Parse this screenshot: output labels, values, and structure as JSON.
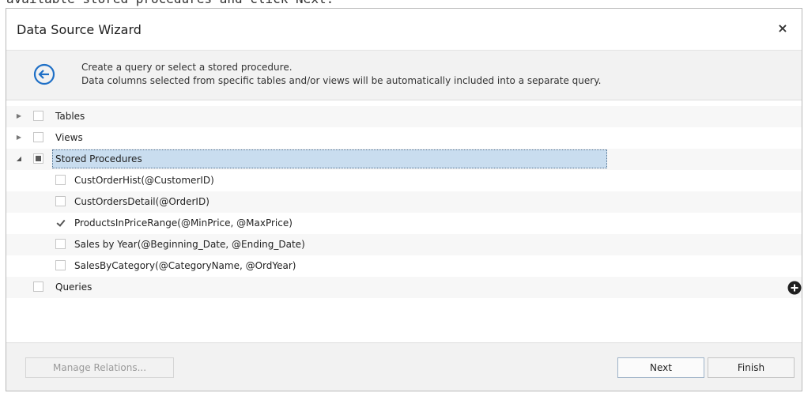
{
  "caption": "available stored procedures and click Next.",
  "dialog": {
    "title": "Data Source Wizard",
    "close_label": "×"
  },
  "header": {
    "line1": "Create a query or select a stored procedure.",
    "line2": "Data columns selected from specific tables and/or views will be automatically included into a separate query."
  },
  "tree": {
    "tables": {
      "label": "Tables",
      "checked": false,
      "expanded": false
    },
    "views": {
      "label": "Views",
      "checked": false,
      "expanded": false
    },
    "stored_procedures": {
      "label": "Stored Procedures",
      "state": "indeterminate",
      "expanded": true,
      "items": [
        {
          "label": "CustOrderHist(@CustomerID)",
          "checked": false
        },
        {
          "label": "CustOrdersDetail(@OrderID)",
          "checked": false
        },
        {
          "label": "ProductsInPriceRange(@MinPrice, @MaxPrice)",
          "checked": true
        },
        {
          "label": "Sales by Year(@Beginning_Date, @Ending_Date)",
          "checked": false
        },
        {
          "label": "SalesByCategory(@CategoryName, @OrdYear)",
          "checked": false
        }
      ]
    },
    "queries": {
      "label": "Queries",
      "checked": false
    }
  },
  "icons": {
    "back": "back-arrow-circle-icon",
    "expand_collapsed": "triangle-right-icon",
    "expand_open": "triangle-down-icon",
    "add": "plus-circle-icon"
  },
  "footer": {
    "manage_relations_label": "Manage Relations...",
    "next_label": "Next",
    "finish_label": "Finish"
  },
  "colors": {
    "accent": "#1e6fc6",
    "selection": "#c9ddef",
    "header_bg": "#f2f2f2"
  }
}
